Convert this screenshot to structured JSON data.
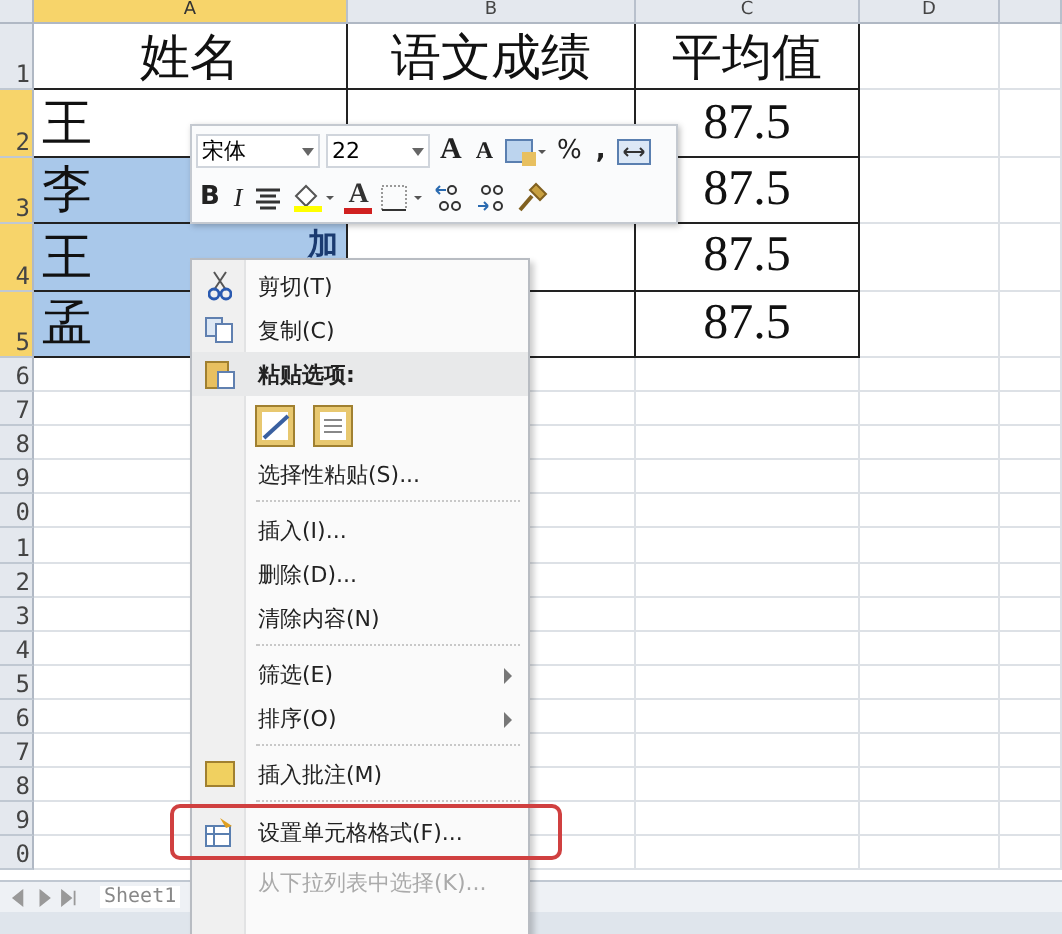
{
  "columns": [
    {
      "label": "A",
      "selected": true
    },
    {
      "label": "B",
      "selected": false
    },
    {
      "label": "C",
      "selected": false
    },
    {
      "label": "D",
      "selected": false
    }
  ],
  "rows": [
    {
      "label": "1",
      "selected": false,
      "cells": [
        {
          "text": "姓名",
          "selected": false
        },
        {
          "text": "语文成绩"
        },
        {
          "text": "平均值"
        },
        {
          "text": ""
        }
      ]
    },
    {
      "label": "2",
      "selected": true,
      "cells": [
        {
          "text": "王",
          "selected": false
        },
        {
          "text": ""
        },
        {
          "text": "87.5"
        },
        {
          "text": ""
        }
      ]
    },
    {
      "label": "3",
      "selected": true,
      "cells": [
        {
          "text": "李",
          "selected": true
        },
        {
          "text": ""
        },
        {
          "text": "87.5"
        },
        {
          "text": ""
        }
      ]
    },
    {
      "label": "4",
      "selected": true,
      "cells": [
        {
          "text": "王",
          "right": "加",
          "selected": true
        },
        {
          "text": ""
        },
        {
          "text": "87.5"
        },
        {
          "text": ""
        }
      ]
    },
    {
      "label": "5",
      "selected": true,
      "cells": [
        {
          "text": "孟",
          "selected": true
        },
        {
          "text": ""
        },
        {
          "text": "87.5"
        },
        {
          "text": ""
        }
      ]
    }
  ],
  "small_rows": [
    "6",
    "7",
    "8",
    "9",
    "0",
    "1",
    "2",
    "3",
    "4",
    "5",
    "6",
    "7",
    "8",
    "9",
    "0"
  ],
  "mini_toolbar": {
    "font": "宋体",
    "size": "22",
    "grow_font": "A",
    "shrink_font": "A",
    "percent": "%",
    "comma": ",",
    "bold": "B",
    "italic": "I",
    "font_color": "A"
  },
  "context_menu": [
    {
      "kind": "item",
      "label": "剪切(T)"
    },
    {
      "kind": "item",
      "label": "复制(C)"
    },
    {
      "kind": "header",
      "label": "粘贴选项:",
      "highlighted": true
    },
    {
      "kind": "paste-icons"
    },
    {
      "kind": "item",
      "label": "选择性粘贴(S)..."
    },
    {
      "kind": "separator"
    },
    {
      "kind": "item",
      "label": "插入(I)..."
    },
    {
      "kind": "item",
      "label": "删除(D)..."
    },
    {
      "kind": "item",
      "label": "清除内容(N)"
    },
    {
      "kind": "separator"
    },
    {
      "kind": "item",
      "label": "筛选(E)",
      "submenu": true
    },
    {
      "kind": "item",
      "label": "排序(O)",
      "submenu": true
    },
    {
      "kind": "separator"
    },
    {
      "kind": "item",
      "label": "插入批注(M)"
    },
    {
      "kind": "separator"
    },
    {
      "kind": "item",
      "label": "设置单元格格式(F)...",
      "marked": true
    },
    {
      "kind": "item",
      "label": "从下拉列表中选择(K)...",
      "disabled": true
    }
  ],
  "sheet_tabs": [
    "Sheet1"
  ]
}
